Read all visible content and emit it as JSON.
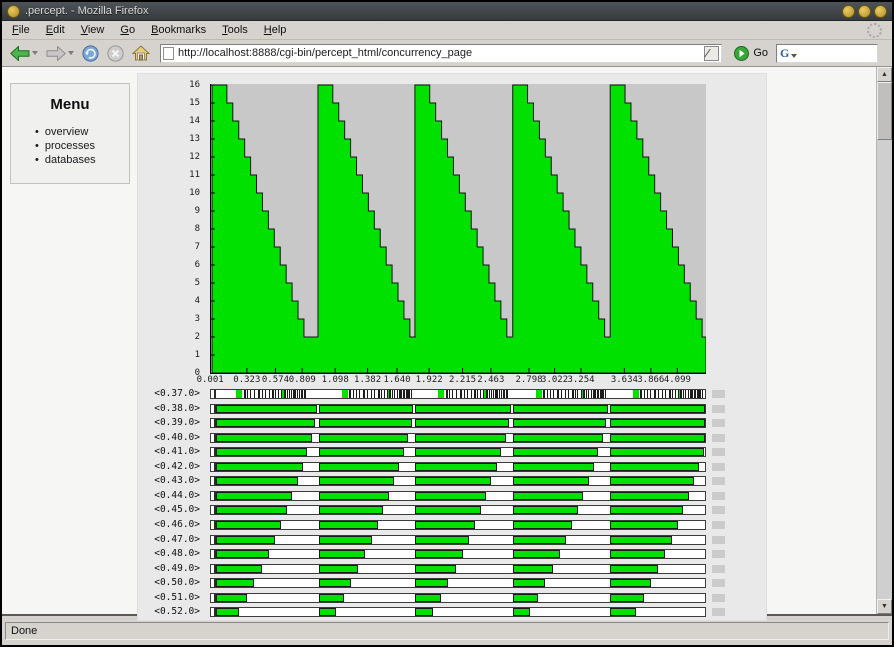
{
  "window": {
    "title": ".percept. - Mozilla Firefox"
  },
  "menubar": {
    "items": [
      "File",
      "Edit",
      "View",
      "Go",
      "Bookmarks",
      "Tools",
      "Help"
    ]
  },
  "toolbar": {
    "url": "http://localhost:8888/cgi-bin/percept_html/concurrency_page",
    "go_label": "Go",
    "search_glyph": "G"
  },
  "sidebar": {
    "title": "Menu",
    "items": [
      "overview",
      "processes",
      "databases"
    ]
  },
  "chart_data": {
    "type": "area",
    "title": "",
    "xlabel": "",
    "ylabel": "",
    "x_max": 4.35,
    "y_max": 16,
    "x_tick_labels": [
      "0.001",
      "0.323",
      "0.574",
      "0.809",
      "1.098",
      "1.382",
      "1.640",
      "1.922",
      "2.215",
      "2.463",
      "2.798",
      "3.022",
      "3.254",
      "3.634",
      "3.866",
      "4.099"
    ],
    "x_tick_values": [
      0.001,
      0.323,
      0.574,
      0.809,
      1.098,
      1.382,
      1.64,
      1.922,
      2.215,
      2.463,
      2.798,
      3.022,
      3.254,
      3.634,
      3.866,
      4.099
    ],
    "y_ticks": [
      0,
      1,
      2,
      3,
      4,
      5,
      6,
      7,
      8,
      9,
      10,
      11,
      12,
      13,
      14,
      15,
      16
    ],
    "teeth_starts": [
      0.018,
      0.947,
      1.797,
      2.655,
      3.51
    ],
    "virtual_next_start": 4.44,
    "tooth_shape": [
      [
        0,
        16
      ],
      [
        0.13,
        16
      ],
      [
        0.13,
        15
      ],
      [
        0.182,
        15
      ],
      [
        0.182,
        14
      ],
      [
        0.234,
        14
      ],
      [
        0.234,
        13
      ],
      [
        0.286,
        13
      ],
      [
        0.286,
        12
      ],
      [
        0.338,
        12
      ],
      [
        0.338,
        11
      ],
      [
        0.39,
        11
      ],
      [
        0.39,
        10
      ],
      [
        0.442,
        10
      ],
      [
        0.442,
        9
      ],
      [
        0.494,
        9
      ],
      [
        0.494,
        8
      ],
      [
        0.546,
        8
      ],
      [
        0.546,
        7
      ],
      [
        0.598,
        7
      ],
      [
        0.598,
        6
      ],
      [
        0.65,
        6
      ],
      [
        0.65,
        5
      ],
      [
        0.702,
        5
      ],
      [
        0.702,
        4
      ],
      [
        0.754,
        4
      ],
      [
        0.754,
        3
      ],
      [
        0.806,
        3
      ],
      [
        0.806,
        2
      ],
      [
        0.858,
        2
      ]
    ],
    "area_color": "#00e100",
    "outline_color": "#141414",
    "plot_bg": "#c8c8c8",
    "legend": null,
    "grid": false
  },
  "process_rows": {
    "labels": [
      "<0.37.0>",
      "<0.38.0>",
      "<0.39.0>",
      "<0.40.0>",
      "<0.41.0>",
      "<0.42.0>",
      "<0.43.0>",
      "<0.44.0>",
      "<0.45.0>",
      "<0.46.0>",
      "<0.47.0>",
      "<0.48.0>",
      "<0.49.0>",
      "<0.50.0>",
      "<0.51.0>",
      "<0.52.0>"
    ],
    "idle_gaps": [
      0.015,
      0.03,
      0.06,
      0.1,
      0.14,
      0.185,
      0.23,
      0.28,
      0.33,
      0.38,
      0.44,
      0.5,
      0.565,
      0.63,
      0.7
    ],
    "start_offset": 0.048,
    "start_tick": 0.03,
    "special_row": {
      "green_tick_offsets": [
        0.205,
        0.223,
        0.241,
        0.604
      ],
      "black_tick_offsets": [
        0.272,
        0.3,
        0.328,
        0.36,
        0.392,
        0.428,
        0.46,
        0.492,
        0.52,
        0.548,
        0.572,
        0.6,
        0.624,
        0.648,
        0.668,
        0.688,
        0.708,
        0.724,
        0.74,
        0.756,
        0.772,
        0.786,
        0.8,
        0.812
      ]
    },
    "green": "#00e100"
  },
  "statusbar": {
    "text": "Done"
  },
  "colors": {
    "titlebar": "#3e4347",
    "chrome": "#d6d3ce",
    "accent_green": "#00e100",
    "plot_bg": "#c8c8c8"
  }
}
